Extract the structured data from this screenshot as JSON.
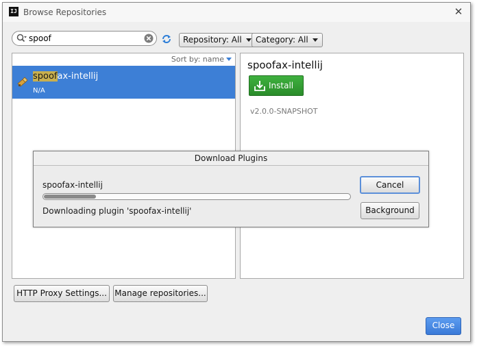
{
  "window": {
    "title": "Browse Repositories",
    "app_icon": "IJ"
  },
  "search": {
    "value": "spoof",
    "placeholder": ""
  },
  "filters": {
    "repository": "Repository: All",
    "category": "Category: All"
  },
  "list": {
    "sort_label": "Sort by: name",
    "items": [
      {
        "name_highlight": "spoof",
        "name_rest": "ax-intellij",
        "subtitle": "N/A"
      }
    ]
  },
  "details": {
    "title": "spoofax-intellij",
    "install_label": "Install",
    "version": "v2.0.0-SNAPSHOT"
  },
  "footer": {
    "proxy_label": "HTTP Proxy Settings...",
    "manage_label": "Manage repositories...",
    "close_label": "Close"
  },
  "download_dialog": {
    "title": "Download Plugins",
    "plugin_name": "spoofax-intellij",
    "status": "Downloading plugin 'spoofax-intellij'",
    "progress": 0.17,
    "cancel_label": "Cancel",
    "background_label": "Background"
  },
  "colors": {
    "selection": "#3d7fd6",
    "highlight": "#c9b04f",
    "install_green": "#2f9a2f",
    "close_blue": "#3a7ad8"
  }
}
